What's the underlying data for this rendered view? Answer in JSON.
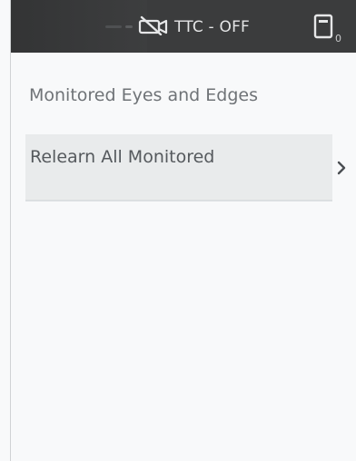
{
  "status_bar": {
    "ttc_status": "TTC - OFF",
    "device_subscript": "0",
    "camera_icon": "camera-off-icon",
    "device_icon": "device-icon"
  },
  "content": {
    "section_heading": "Monitored Eyes and Edges",
    "items": [
      {
        "label": "Relearn All Monitored",
        "icon": "chevron-right-icon"
      }
    ]
  },
  "colors": {
    "status_bar_bg": "#3b3c3d",
    "page_bg": "#f8f9fa",
    "item_bg": "#e9ebec",
    "heading_text": "#6f7377"
  }
}
